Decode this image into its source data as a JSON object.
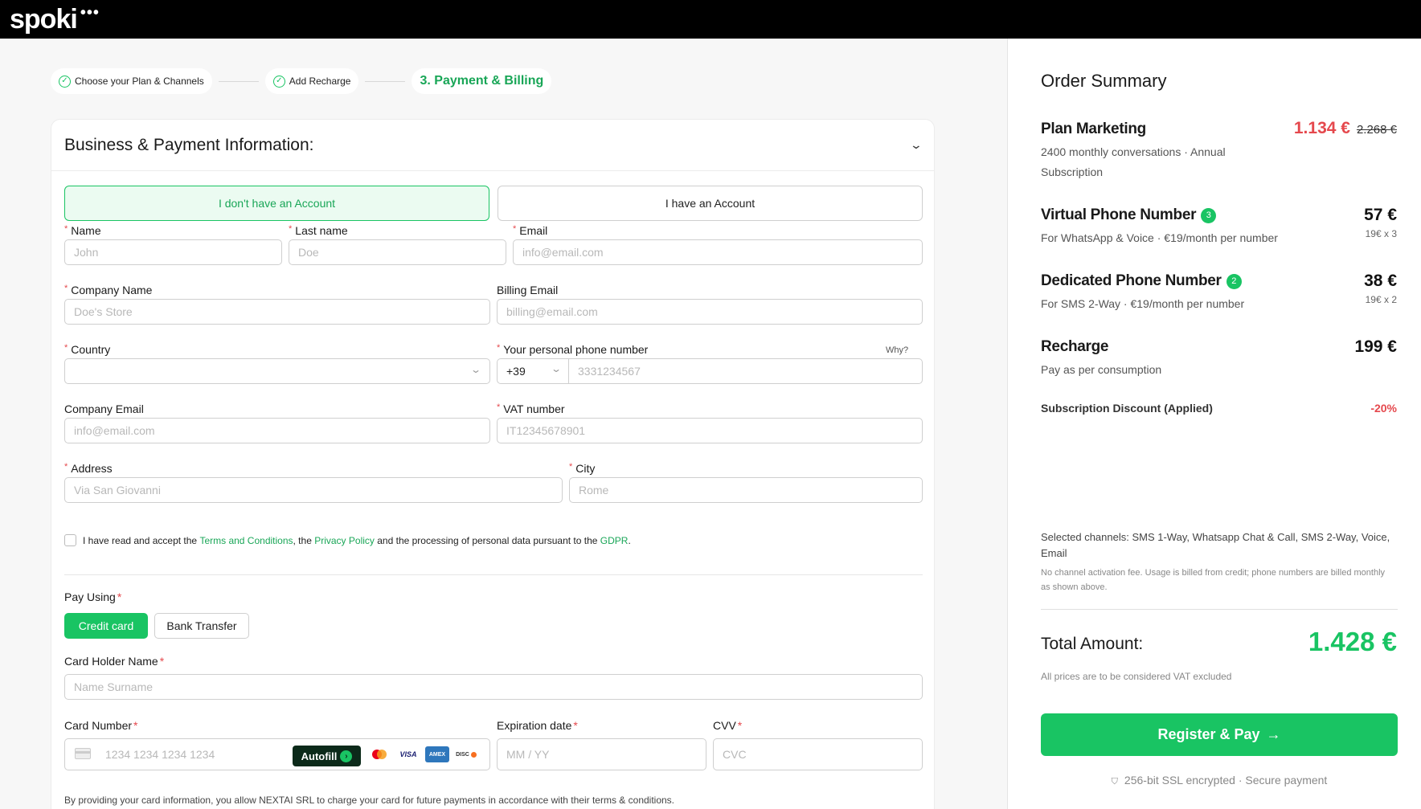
{
  "brand": {
    "logo": "spoki",
    "logo_dots": "•••"
  },
  "steps": [
    {
      "label": "Choose your Plan & Channels",
      "done": true
    },
    {
      "label": "Add Recharge",
      "done": true
    },
    {
      "label": "3. Payment & Billing",
      "done": false
    }
  ],
  "form": {
    "title": "Business & Payment Information:",
    "account_tabs": {
      "no_account": "I don't have an Account",
      "has_account": "I have an Account"
    },
    "fields": {
      "name": {
        "label": "Name",
        "placeholder": "John"
      },
      "last_name": {
        "label": "Last name",
        "placeholder": "Doe"
      },
      "email": {
        "label": "Email",
        "placeholder": "info@email.com"
      },
      "company_name": {
        "label": "Company Name",
        "placeholder": "Doe's Store"
      },
      "billing_email": {
        "label": "Billing Email",
        "placeholder": "billing@email.com"
      },
      "country": {
        "label": "Country",
        "value": ""
      },
      "phone": {
        "label": "Your personal phone number",
        "why": "Why?",
        "prefix": "+39",
        "placeholder": "3331234567"
      },
      "company_email": {
        "label": "Company Email",
        "placeholder": "info@email.com"
      },
      "vat": {
        "label": "VAT number",
        "placeholder": "IT12345678901"
      },
      "address": {
        "label": "Address",
        "placeholder": "Via San Giovanni"
      },
      "city": {
        "label": "City",
        "placeholder": "Rome"
      }
    },
    "terms": {
      "pre": "I have read and accept the ",
      "terms_link": "Terms and Conditions",
      "mid1": ", the ",
      "privacy_link": "Privacy Policy",
      "mid2": " and the processing of personal data pursuant to the ",
      "gdpr_link": "GDPR",
      "post": "."
    },
    "pay_using": {
      "label": "Pay Using",
      "credit_card": "Credit card",
      "bank_transfer": "Bank Transfer"
    },
    "card_holder": {
      "label": "Card Holder Name",
      "placeholder": "Name Surname"
    },
    "card_number": {
      "label": "Card Number",
      "placeholder": "1234 1234 1234 1234",
      "autofill": "Autofill"
    },
    "card_brands": {
      "visa": "VISA",
      "amex": "AMEX",
      "disc": "DISC"
    },
    "expiration": {
      "label": "Expiration date",
      "placeholder": "MM / YY"
    },
    "cvv": {
      "label": "CVV",
      "placeholder": "CVC"
    },
    "disclaimer": "By providing your card information, you allow NEXTAI SRL to charge your card for future payments in accordance with their terms & conditions."
  },
  "summary": {
    "title": "Order Summary",
    "items": [
      {
        "name": "Plan Marketing",
        "desc_line1": "2400 monthly conversations · Annual",
        "desc_line2": "Subscription",
        "price": "1.134 €",
        "old_price": "2.268 €"
      },
      {
        "name": "Virtual Phone Number",
        "badge": "3",
        "desc": "For WhatsApp & Voice · €19/month per number",
        "price": "57 €",
        "sub": "19€ x 3"
      },
      {
        "name": "Dedicated Phone Number",
        "badge": "2",
        "desc": "For SMS 2-Way · €19/month per number",
        "price": "38 €",
        "sub": "19€ x 2"
      },
      {
        "name": "Recharge",
        "desc": "Pay as per consumption",
        "price": "199 €"
      }
    ],
    "discount": {
      "label": "Subscription Discount (Applied)",
      "value": "-20%"
    },
    "channels": "Selected channels: SMS 1-Way, Whatsapp Chat & Call, SMS 2-Way, Voice, Email",
    "channels_note": "No channel activation fee. Usage is billed from credit; phone numbers are billed monthly as shown above.",
    "total_label": "Total Amount:",
    "total_value": "1.428 €",
    "vat_note": "All prices are to be considered VAT excluded",
    "cta": "Register & Pay",
    "ssl": "256-bit SSL encrypted · Secure payment"
  },
  "colors": {
    "accent": "#19c463",
    "accent_text": "#19a657",
    "danger": "#e5484d",
    "topbar": "#000000"
  }
}
